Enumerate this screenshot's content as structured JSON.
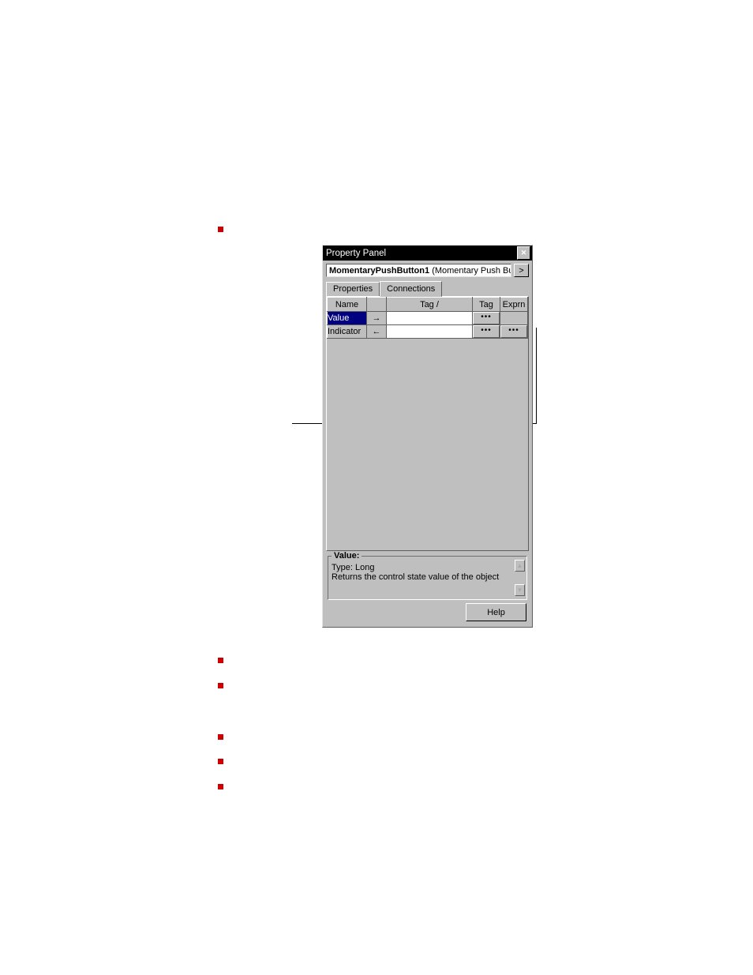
{
  "panel": {
    "title": "Property Panel",
    "object_name": "MomentaryPushButton1",
    "object_type": "(Momentary Push Bu",
    "tabs": {
      "properties": "Properties",
      "connections": "Connections"
    },
    "headers": {
      "name": "Name",
      "tag_exp": "Tag /",
      "tag": "Tag",
      "exprn": "Exprn"
    },
    "rows": [
      {
        "name": "Value",
        "arrow": "→",
        "tagexp": "",
        "tag_btn": "•••",
        "exprn_btn": ""
      },
      {
        "name": "Indicator",
        "arrow": "←",
        "tagexp": "",
        "tag_btn": "•••",
        "exprn_btn": "•••"
      }
    ],
    "desc": {
      "legend": "Value:",
      "type": "Type: Long",
      "text": "Returns the control state value of the object"
    },
    "help": "Help"
  }
}
